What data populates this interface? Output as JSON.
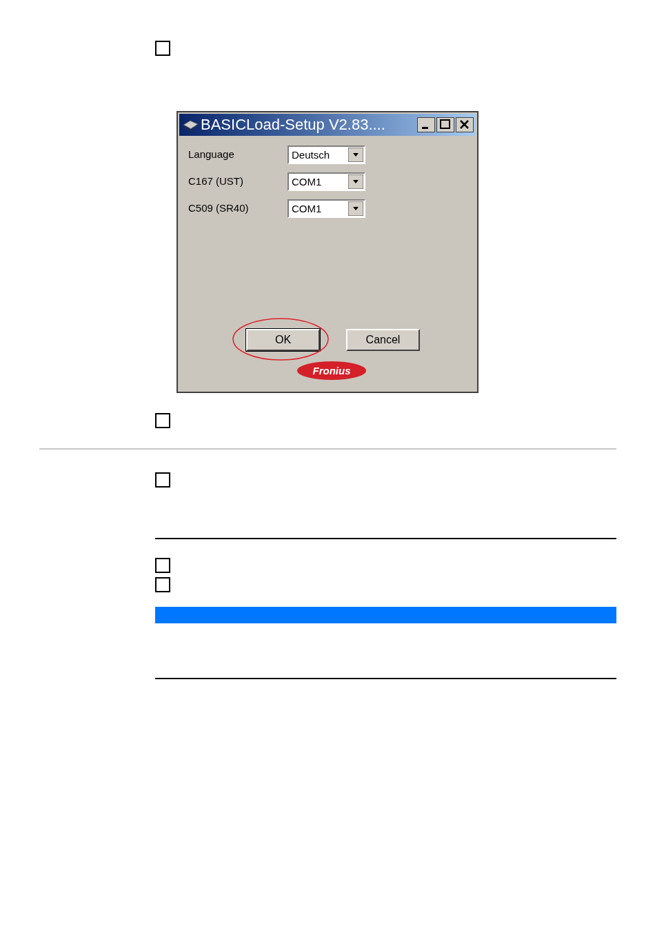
{
  "page_items": [
    {
      "kind": "step",
      "checked": false
    },
    {
      "kind": "dialog",
      "title": "BASICLoad-Setup V2.83....",
      "fields": [
        {
          "label": "Language",
          "value": "Deutsch"
        },
        {
          "label": "C167 (UST)",
          "value": "COM1"
        },
        {
          "label": "C509 (SR40)",
          "value": "COM1"
        }
      ],
      "buttons": [
        {
          "label": "OK",
          "default": true,
          "highlighted": true
        },
        {
          "label": "Cancel",
          "default": false,
          "highlighted": false
        }
      ],
      "logo": "Fronius"
    },
    {
      "kind": "step",
      "checked": false
    },
    {
      "kind": "section_divider"
    },
    {
      "kind": "step",
      "checked": false
    },
    {
      "kind": "rule"
    },
    {
      "kind": "step",
      "checked": false
    },
    {
      "kind": "step",
      "checked": false
    },
    {
      "kind": "note_bar",
      "color": "#0077ff"
    },
    {
      "kind": "rule"
    }
  ]
}
